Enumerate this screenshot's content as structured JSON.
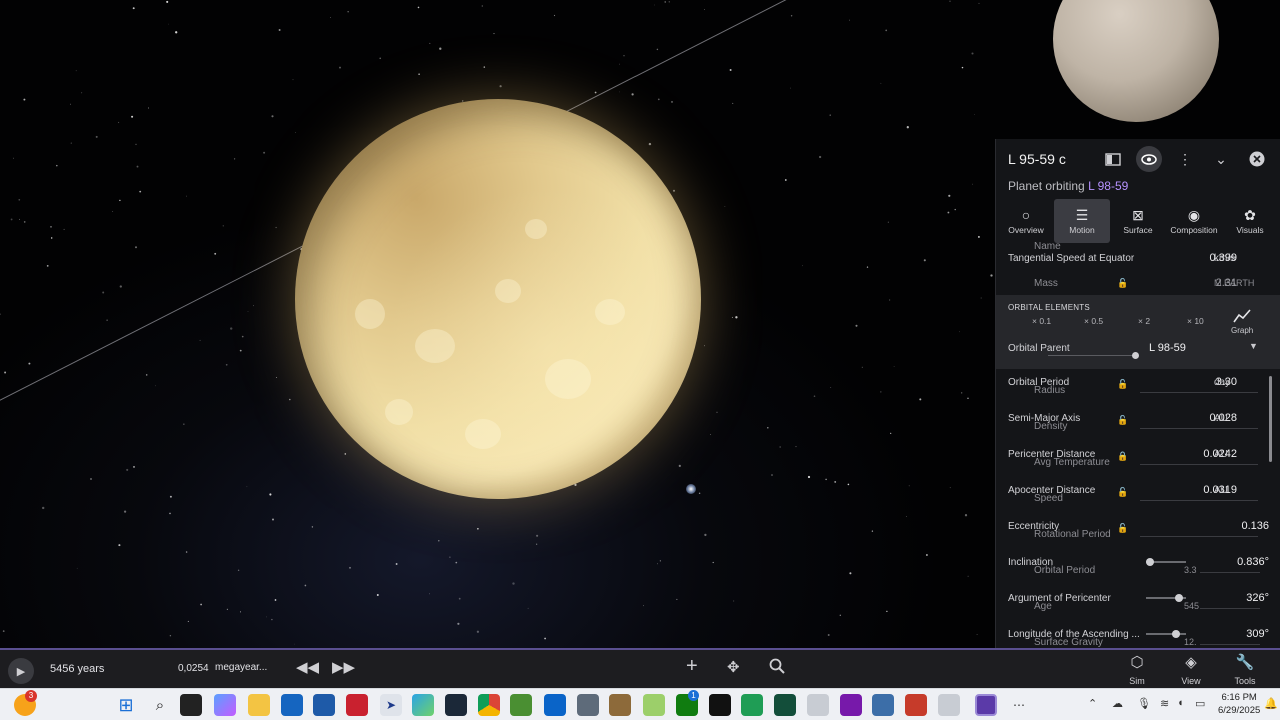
{
  "colors": {
    "accent_link": "#b792ff",
    "panel_bg": "#16171a",
    "sim_bar_border": "#5a4f90"
  },
  "panel": {
    "title": "L 95-59 c",
    "subtitle_prefix": "Planet orbiting ",
    "parent_link": "L 98-59",
    "header_icons": [
      "sidebar-icon",
      "eye-icon",
      "more-icon",
      "chevron-down-icon",
      "close-icon"
    ],
    "tabs": [
      {
        "label": "Overview",
        "icon": "circle-icon"
      },
      {
        "label": "Motion",
        "icon": "motion-icon"
      },
      {
        "label": "Surface",
        "icon": "surface-icon"
      },
      {
        "label": "Composition",
        "icon": "composition-icon"
      },
      {
        "label": "Visuals",
        "icon": "palette-icon"
      }
    ],
    "active_tab": "Motion",
    "ghost_name_label": "Name",
    "tangential_speed": {
      "label": "Tangential Speed at Equator",
      "value": "0.399",
      "unit": "km/s"
    },
    "mass": {
      "label": "Mass",
      "value": "2.31",
      "unit": "M EARTH"
    },
    "orbital_elements": {
      "title": "ORBITAL ELEMENTS",
      "speeds": [
        "× 0.1",
        "× 0.5",
        "× 2",
        "× 10"
      ],
      "graph_label": "Graph"
    },
    "orbital_parent": {
      "label": "Orbital Parent",
      "value": "L 98-59"
    },
    "rows": [
      {
        "label": "Orbital Period",
        "ghost": "Radius",
        "value": "3.30",
        "unit": "day"
      },
      {
        "label": "Semi-Major Axis",
        "ghost": "Density",
        "value": "0.028",
        "unit": "AU"
      },
      {
        "label": "Pericenter Distance",
        "ghost": "Avg Temperature",
        "value": "0.0242",
        "unit": "AU"
      },
      {
        "label": "Apocenter Distance",
        "ghost": "Speed",
        "value": "0.0319",
        "unit": "AU"
      },
      {
        "label": "Eccentricity",
        "ghost": "Rotational Period",
        "value": "0.136",
        "unit": ""
      },
      {
        "label": "Inclination",
        "ghost": "Orbital Period",
        "value": "0.836°",
        "unit": "",
        "under": "3.3"
      },
      {
        "label": "Argument of Pericenter",
        "ghost": "Age",
        "value": "326°",
        "unit": "",
        "under": "545"
      },
      {
        "label": "Longitude of the Ascending ...",
        "ghost": "Surface Gravity",
        "value": "309°",
        "unit": "",
        "under": "12."
      }
    ]
  },
  "simbar": {
    "time_elapsed": "5456 years",
    "rate_value": "0,0254",
    "rate_unit": "megayear...",
    "tools": [
      {
        "label": "Sim",
        "icon": "cube-icon"
      },
      {
        "label": "View",
        "icon": "layers-icon"
      },
      {
        "label": "Tools",
        "icon": "wrench-icon"
      }
    ]
  },
  "taskbar": {
    "notification_count": "3",
    "badge_count": "1",
    "time": "6:16 PM",
    "date": "6/29/2025"
  }
}
